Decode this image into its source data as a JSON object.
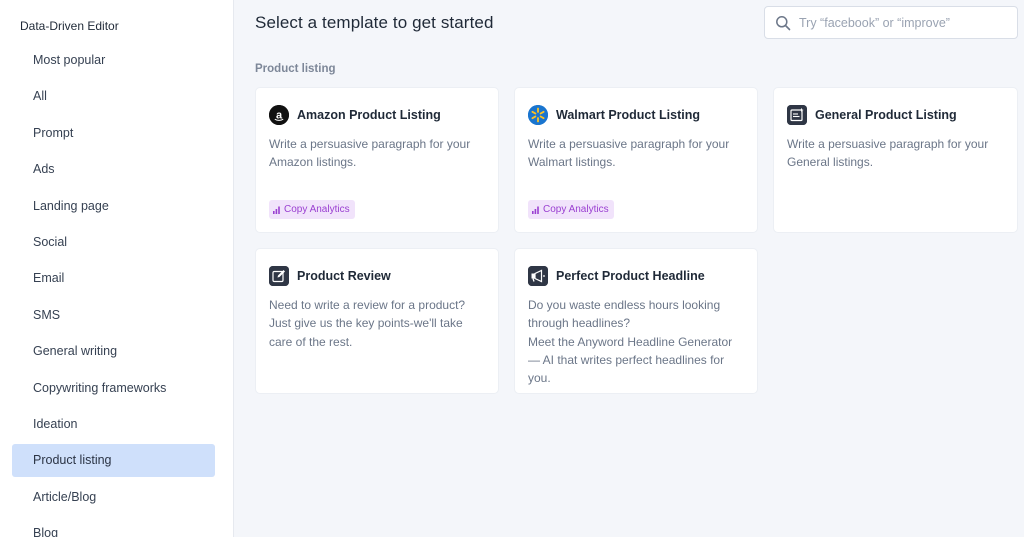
{
  "sidebar": {
    "title": "Data-Driven Editor",
    "items": [
      {
        "label": "Most popular"
      },
      {
        "label": "All"
      },
      {
        "label": "Prompt"
      },
      {
        "label": "Ads"
      },
      {
        "label": "Landing page"
      },
      {
        "label": "Social"
      },
      {
        "label": "Email"
      },
      {
        "label": "SMS"
      },
      {
        "label": "General writing"
      },
      {
        "label": "Copywriting frameworks"
      },
      {
        "label": "Ideation"
      },
      {
        "label": "Product listing",
        "active": true
      },
      {
        "label": "Article/Blog"
      },
      {
        "label": "Blog"
      }
    ]
  },
  "header": {
    "title": "Select a template to get started",
    "search_placeholder": "Try “facebook” or “improve”"
  },
  "section": {
    "label": "Product listing"
  },
  "cards": [
    {
      "icon": "amazon-icon",
      "title": "Amazon Product Listing",
      "description": "Write a persuasive paragraph for your Amazon listings.",
      "badge": "Copy Analytics"
    },
    {
      "icon": "walmart-icon",
      "title": "Walmart Product Listing",
      "description": "Write a persuasive paragraph for your Walmart listings.",
      "badge": "Copy Analytics"
    },
    {
      "icon": "document-sparkle-icon",
      "title": "General Product Listing",
      "description": "Write a persuasive paragraph for your General listings."
    },
    {
      "icon": "edit-square-icon",
      "title": "Product Review",
      "description": "Need to write a review for a product? Just give us the key points-we'll take care of the rest."
    },
    {
      "icon": "megaphone-icon",
      "title": "Perfect Product Headline",
      "description": "Do you waste endless hours looking through headlines?\nMeet the Anyword Headline Generator — AI that writes perfect headlines for you."
    }
  ],
  "colors": {
    "active_item_bg": "#cfe0fb",
    "badge_bg": "#f1e3fb",
    "badge_text": "#9a3fd1",
    "walmart_blue": "#1a75cf",
    "walmart_yellow": "#ffc220"
  }
}
